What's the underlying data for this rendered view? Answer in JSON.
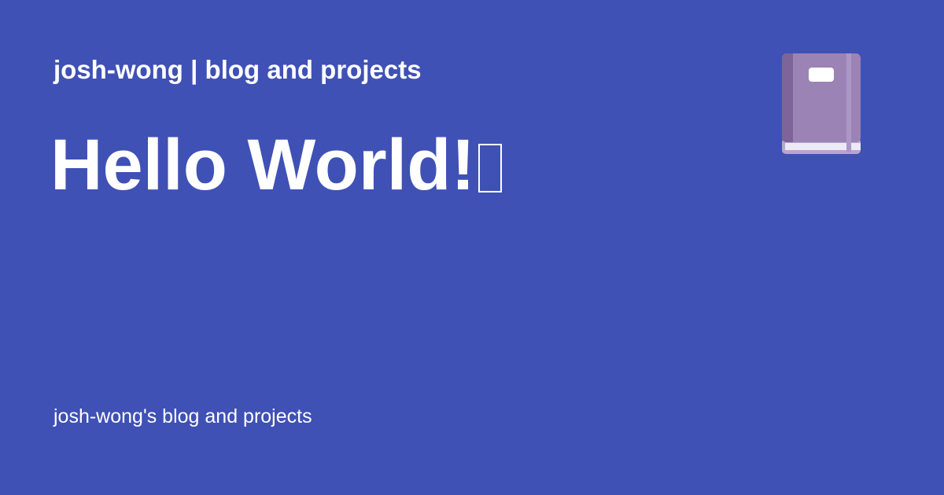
{
  "header": {
    "site_title": "josh-wong | blog and projects"
  },
  "main": {
    "heading": "Hello World!"
  },
  "footer": {
    "description": "josh-wong's blog and projects"
  },
  "icons": {
    "header_icon": "book-icon",
    "heading_trailing": "missing-glyph-icon"
  },
  "colors": {
    "background": "#3f51b5",
    "text": "#ffffff",
    "book_cover": "#9c83b5",
    "book_spine": "#7e6499",
    "book_pages": "#e8e8f0"
  }
}
